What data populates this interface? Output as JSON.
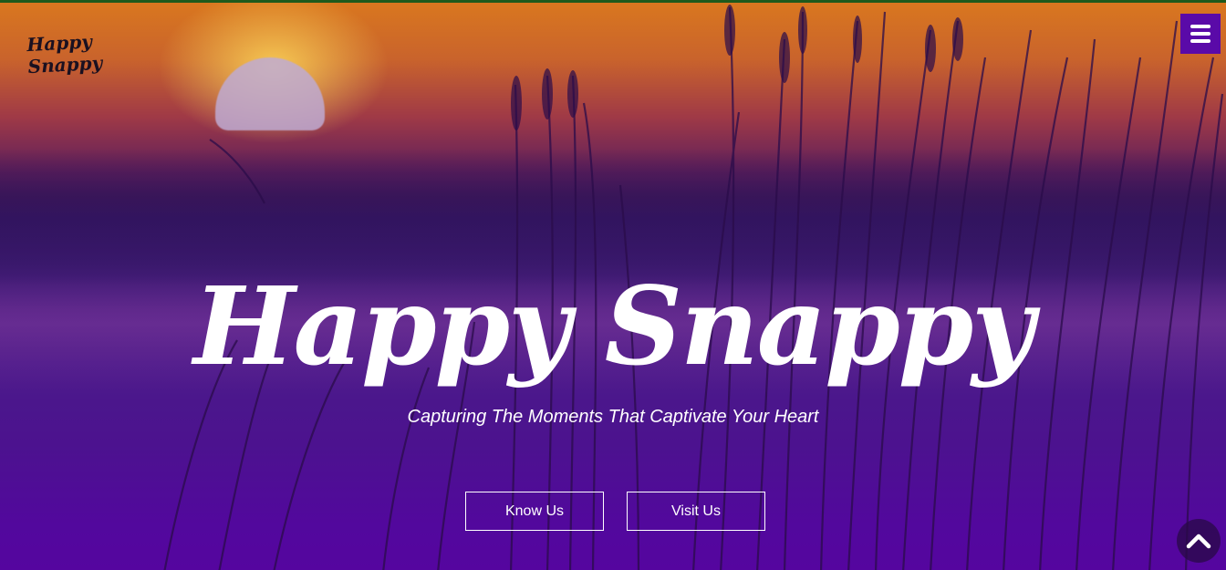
{
  "brand": {
    "logo_line1": "Happy",
    "logo_line2": "Snappy"
  },
  "header": {
    "menu_icon": "hamburger-menu-icon",
    "menu_color": "#5a0aa8"
  },
  "hero": {
    "title": "Happy Snappy",
    "tagline": "Capturing The Moments That Captivate Your Heart",
    "buttons": {
      "know_label": "Know Us",
      "visit_label": "Visit Us"
    },
    "background_description_colors": {
      "sky_top": "#d9771f",
      "bottom": "#55059f"
    }
  },
  "footer": {
    "scroll_top_icon": "chevron-up-icon"
  }
}
